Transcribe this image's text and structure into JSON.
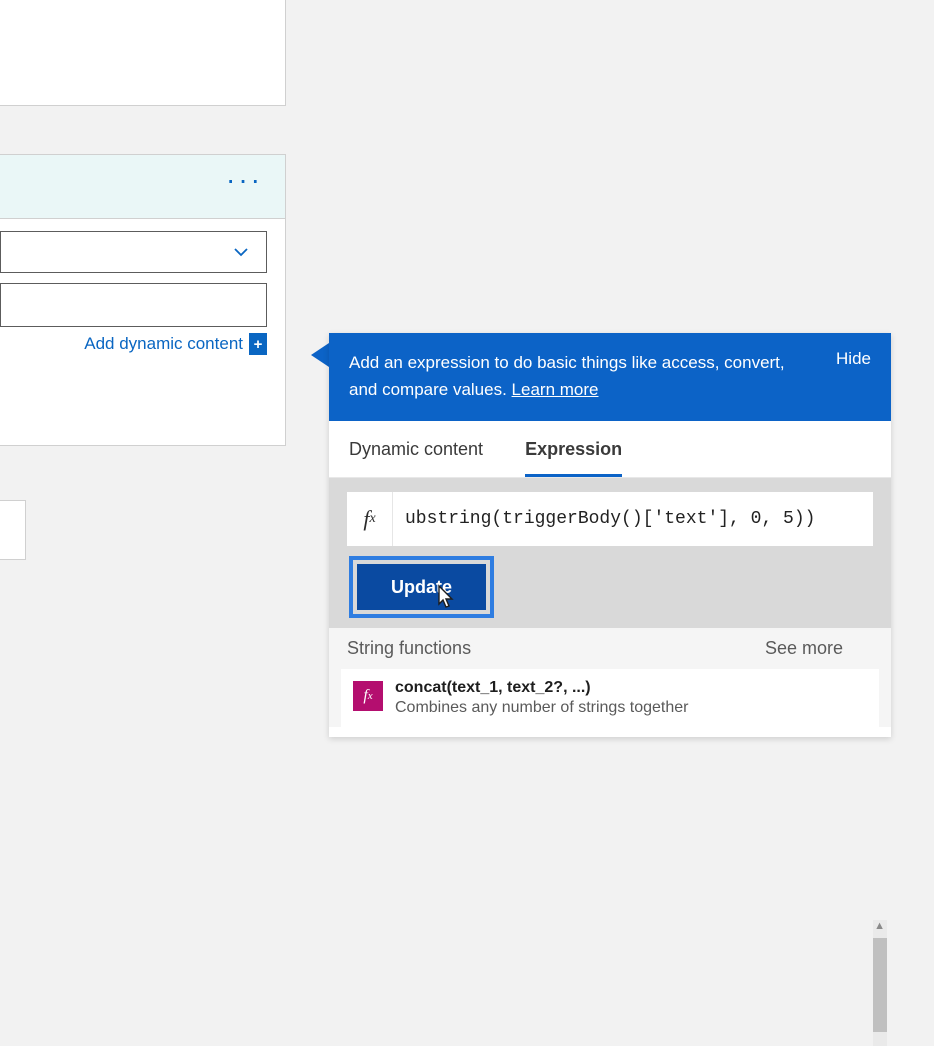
{
  "left_card": {
    "add_dynamic_label": "Add dynamic content"
  },
  "expression_panel": {
    "header_text_part1": "Add an expression to do basic things like access, convert, and compare values. ",
    "learn_more": "Learn more",
    "hide": "Hide",
    "tabs": {
      "dynamic": "Dynamic content",
      "expression": "Expression"
    },
    "formula": "ubstring(triggerBody()['text'], 0, 5))",
    "update_label": "Update",
    "suggestions": {
      "section_title": "String functions",
      "see_more": "See more",
      "items": [
        {
          "title": "concat(text_1, text_2?, ...)",
          "description": "Combines any number of strings together"
        }
      ]
    }
  }
}
